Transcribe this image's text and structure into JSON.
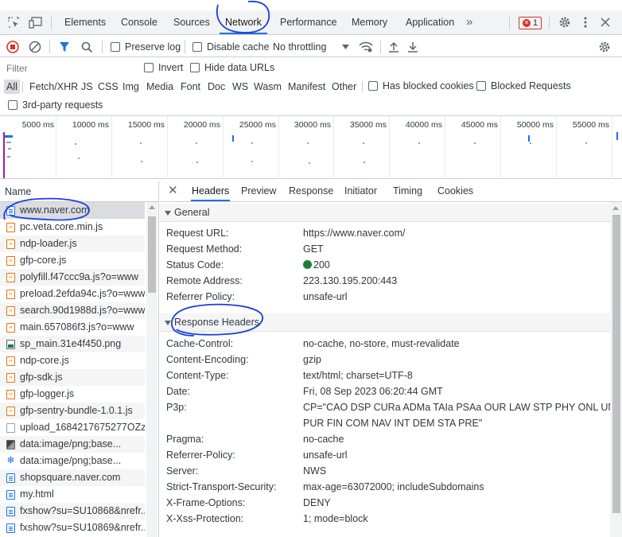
{
  "tabs": {
    "items": [
      "Elements",
      "Console",
      "Sources",
      "Network",
      "Performance",
      "Memory",
      "Application"
    ],
    "active": "Network",
    "more": "»",
    "error_count": "1"
  },
  "toolbar": {
    "preserve_log": "Preserve log",
    "disable_cache": "Disable cache",
    "throttling": "No throttling"
  },
  "filter": {
    "placeholder": "Filter",
    "invert": "Invert",
    "hide_data_urls": "Hide data URLs"
  },
  "types": {
    "items": [
      "All",
      "Fetch/XHR",
      "JS",
      "CSS",
      "Img",
      "Media",
      "Font",
      "Doc",
      "WS",
      "Wasm",
      "Manifest",
      "Other"
    ],
    "has_blocked_cookies": "Has blocked cookies",
    "blocked_requests": "Blocked Requests",
    "third_party": "3rd-party requests"
  },
  "overview": {
    "ticks": [
      "5000 ms",
      "10000 ms",
      "15000 ms",
      "20000 ms",
      "25000 ms",
      "30000 ms",
      "35000 ms",
      "40000 ms",
      "45000 ms",
      "50000 ms",
      "55000 ms"
    ]
  },
  "requests": {
    "header": "Name",
    "items": [
      {
        "name": "www.naver.com",
        "type": "doc"
      },
      {
        "name": "pc.veta.core.min.js",
        "type": "js"
      },
      {
        "name": "ndp-loader.js",
        "type": "js"
      },
      {
        "name": "gfp-core.js",
        "type": "js"
      },
      {
        "name": "polyfill.f47ccc9a.js?o=www",
        "type": "js"
      },
      {
        "name": "preload.2efda94c.js?o=www",
        "type": "js"
      },
      {
        "name": "search.90d1988d.js?o=www",
        "type": "js"
      },
      {
        "name": "main.657086f3.js?o=www",
        "type": "js"
      },
      {
        "name": "sp_main.31e4f450.png",
        "type": "img"
      },
      {
        "name": "ndp-core.js",
        "type": "js"
      },
      {
        "name": "gfp-sdk.js",
        "type": "js"
      },
      {
        "name": "gfp-logger.js",
        "type": "js"
      },
      {
        "name": "gfp-sentry-bundle-1.0.1.js",
        "type": "js"
      },
      {
        "name": "upload_1684217675277OZz...",
        "type": "js2"
      },
      {
        "name": "data:image/png;base...",
        "type": "dataimg"
      },
      {
        "name": "data:image/png;base...",
        "type": "cog"
      },
      {
        "name": "shopsquare.naver.com",
        "type": "doc"
      },
      {
        "name": "my.html",
        "type": "doc"
      },
      {
        "name": "fxshow?su=SU10868&nrefr...",
        "type": "doc"
      },
      {
        "name": "fxshow?su=SU10869&nrefr...",
        "type": "doc"
      }
    ]
  },
  "details": {
    "tabs": [
      "Headers",
      "Preview",
      "Response",
      "Initiator",
      "Timing",
      "Cookies"
    ],
    "active_tab": "Headers",
    "general": {
      "title": "General",
      "rows": [
        {
          "k": "Request URL:",
          "v": "https://www.naver.com/"
        },
        {
          "k": "Request Method:",
          "v": "GET"
        },
        {
          "k": "Status Code:",
          "v": "200"
        },
        {
          "k": "Remote Address:",
          "v": "223.130.195.200:443"
        },
        {
          "k": "Referrer Policy:",
          "v": "unsafe-url"
        }
      ]
    },
    "response": {
      "title": "Response Headers",
      "rows": [
        {
          "k": "Cache-Control:",
          "v": "no-cache, no-store, must-revalidate"
        },
        {
          "k": "Content-Encoding:",
          "v": "gzip"
        },
        {
          "k": "Content-Type:",
          "v": "text/html; charset=UTF-8"
        },
        {
          "k": "Date:",
          "v": "Fri, 08 Sep 2023 06:20:44 GMT"
        },
        {
          "k": "P3p:",
          "v": "CP=\"CAO DSP CURa ADMa TAIa PSAa OUR LAW STP PHY ONL UNI",
          "v2": "PUR FIN COM NAV INT DEM STA PRE\""
        },
        {
          "k": "Pragma:",
          "v": "no-cache"
        },
        {
          "k": "Referrer-Policy:",
          "v": "unsafe-url"
        },
        {
          "k": "Server:",
          "v": "NWS"
        },
        {
          "k": "Strict-Transport-Security:",
          "v": "max-age=63072000; includeSubdomains"
        },
        {
          "k": "X-Frame-Options:",
          "v": "DENY"
        },
        {
          "k": "X-Xss-Protection:",
          "v": "1; mode=block"
        }
      ]
    }
  },
  "colors": {
    "accent": "#1a73e8",
    "annotation": "#1a3ee0",
    "status_ok": "#188038",
    "error": "#d93025"
  }
}
